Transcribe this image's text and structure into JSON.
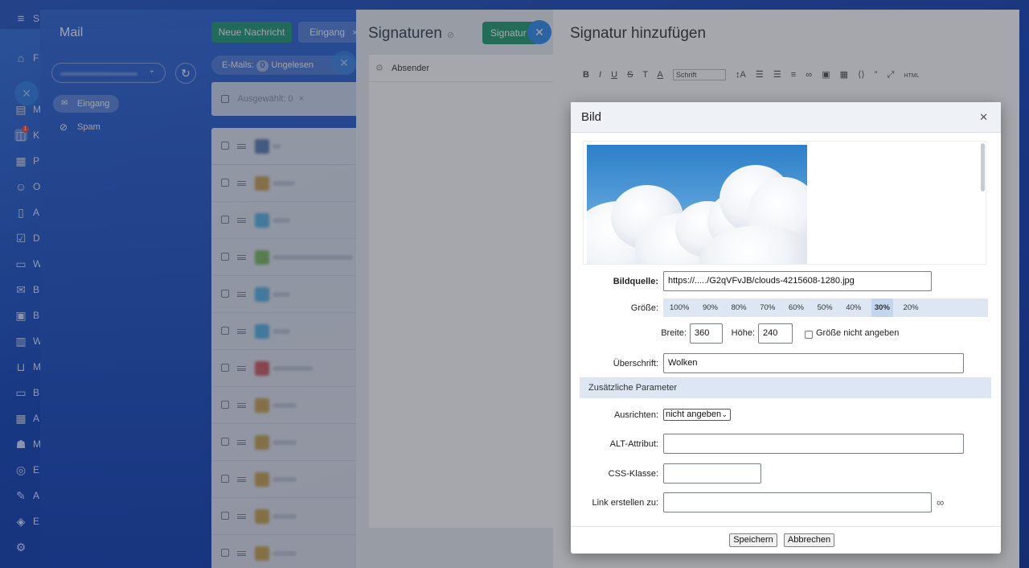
{
  "bg": {
    "menu_icon": "≡",
    "nav_letters": [
      "S",
      "F",
      "M",
      "K",
      "P",
      "O",
      "A",
      "D",
      "W",
      "B",
      "B",
      "W",
      "M",
      "B",
      "A",
      "M",
      "E",
      "A",
      "E"
    ],
    "notify_badge": "1"
  },
  "mail": {
    "title": "Mail",
    "new_message_label": "Neue Nachricht",
    "inbox_filter_label": "Eingang",
    "emails_label": "E-Mails:",
    "emails_count": "0",
    "unread_label": "Ungelesen",
    "selected_label": "Ausgewählt: 0",
    "folders": [
      {
        "label": "Eingang"
      },
      {
        "label": "Spam"
      }
    ]
  },
  "signatures": {
    "title": "Signaturen",
    "add_button_label": "Signatur",
    "sender_label": "Absender"
  },
  "editor": {
    "title": "Signatur hinzufügen",
    "font_select_label": "Schrift"
  },
  "image_dialog": {
    "title": "Bild",
    "source_label": "Bildquelle:",
    "source_value": "https://...../G2qVFvJB/clouds-4215608-1280.jpg",
    "size_label": "Größe:",
    "sizes": [
      "100%",
      "90%",
      "80%",
      "70%",
      "60%",
      "50%",
      "40%",
      "30%",
      "20%"
    ],
    "selected_size": "30%",
    "width_label": "Breite:",
    "width_value": "360",
    "height_label": "Höhe:",
    "height_value": "240",
    "no_size_label": "Größe nicht angeben",
    "caption_label": "Überschrift:",
    "caption_value": "Wolken",
    "additional_params_label": "Zusätzliche Parameter",
    "align_label": "Ausrichten:",
    "align_value": "nicht angeben",
    "alt_label": "ALT-Attribut:",
    "css_label": "CSS-Klasse:",
    "link_label": "Link erstellen zu:",
    "save_label": "Speichern",
    "cancel_label": "Abbrechen"
  }
}
